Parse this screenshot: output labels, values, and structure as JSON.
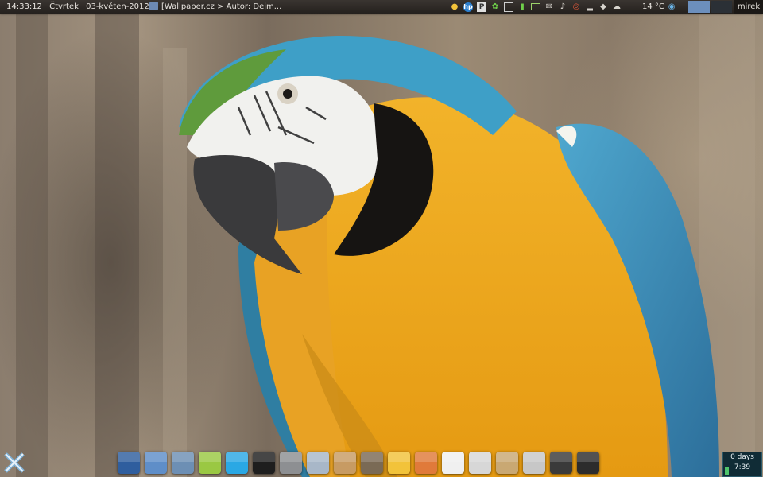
{
  "top_panel": {
    "time": "14:33:12",
    "weekday": "Čtvrtek",
    "date": "03-květen-2012",
    "task_title": "[Wallpaper.cz > Autor: Dejm...",
    "weather": "14 °C",
    "user": "mirek",
    "tray_icons": [
      "duck-icon",
      "hp-icon",
      "p-icon",
      "leaf-icon",
      "window-icon",
      "battery-icon",
      "network-icon",
      "mail-icon",
      "volume-icon",
      "alarm-icon",
      "signal-icon",
      "dropbox-icon",
      "cloud-icon",
      "wifi-icon"
    ]
  },
  "dock": {
    "items": [
      {
        "name": "blue-app-icon",
        "color": "#2f5e9e"
      },
      {
        "name": "disk-icon",
        "color": "#5f8ec8"
      },
      {
        "name": "mail-stamp-icon",
        "color": "#6d8fb4"
      },
      {
        "name": "contacts-icon",
        "color": "#9ac843"
      },
      {
        "name": "skype-icon",
        "color": "#2aa8e4"
      },
      {
        "name": "terminal-icon",
        "color": "#1e1e1e"
      },
      {
        "name": "mixer-icon",
        "color": "#8d8f92"
      },
      {
        "name": "search-icon",
        "color": "#a8b7c8"
      },
      {
        "name": "package-icon",
        "color": "#c79b63"
      },
      {
        "name": "speaker-icon",
        "color": "#7a6a55"
      },
      {
        "name": "cheese-icon",
        "color": "#f2c33a"
      },
      {
        "name": "paint-icon",
        "color": "#e07a3a"
      },
      {
        "name": "picasa-icon",
        "color": "#f0f0f0"
      },
      {
        "name": "calculator-icon",
        "color": "#d7d7d7"
      },
      {
        "name": "folder-icon",
        "color": "#c9a873"
      },
      {
        "name": "trash-icon",
        "color": "#c7c7c7"
      },
      {
        "name": "camera-icon",
        "color": "#3a3a3a"
      },
      {
        "name": "monitor-icon",
        "color": "#2c2c2c"
      }
    ]
  },
  "uptime": {
    "days": "0 days",
    "time": "7:39"
  }
}
